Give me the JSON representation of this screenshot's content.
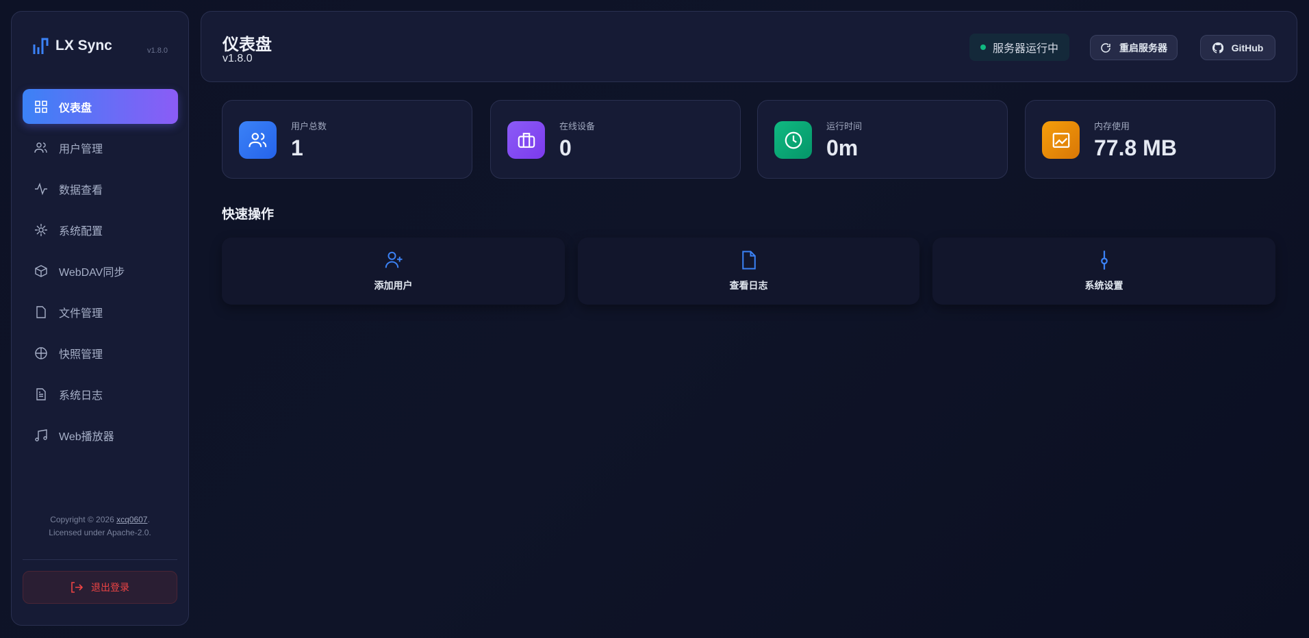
{
  "sidebar": {
    "app_name": "LX Sync",
    "version": "v1.8.0",
    "items": [
      {
        "label": "仪表盘"
      },
      {
        "label": "用户管理"
      },
      {
        "label": "数据查看"
      },
      {
        "label": "系统配置"
      },
      {
        "label": "WebDAV同步"
      },
      {
        "label": "文件管理"
      },
      {
        "label": "快照管理"
      },
      {
        "label": "系统日志"
      },
      {
        "label": "Web播放器"
      }
    ],
    "copyright_prefix": "Copyright © 2026 ",
    "copyright_link": "xcq0607",
    "copyright_suffix": ".",
    "license": "Licensed under Apache-2.0.",
    "logout": "退出登录"
  },
  "header": {
    "title": "仪表盘",
    "subtitle": "v1.8.0",
    "status": "服务器运行中",
    "restart": "重启服务器",
    "github": "GitHub"
  },
  "stats": [
    {
      "label": "用户总数",
      "value": "1"
    },
    {
      "label": "在线设备",
      "value": "0"
    },
    {
      "label": "运行时间",
      "value": "0m"
    },
    {
      "label": "内存使用",
      "value": "77.8 MB"
    }
  ],
  "quick": {
    "title": "快速操作",
    "items": [
      {
        "label": "添加用户"
      },
      {
        "label": "查看日志"
      },
      {
        "label": "系统设置"
      }
    ]
  },
  "colors": {
    "blue": "#3b82f6",
    "purple": "#8b5cf6",
    "green": "#10b981",
    "orange": "#f59e0b",
    "danger": "#ef4444"
  }
}
